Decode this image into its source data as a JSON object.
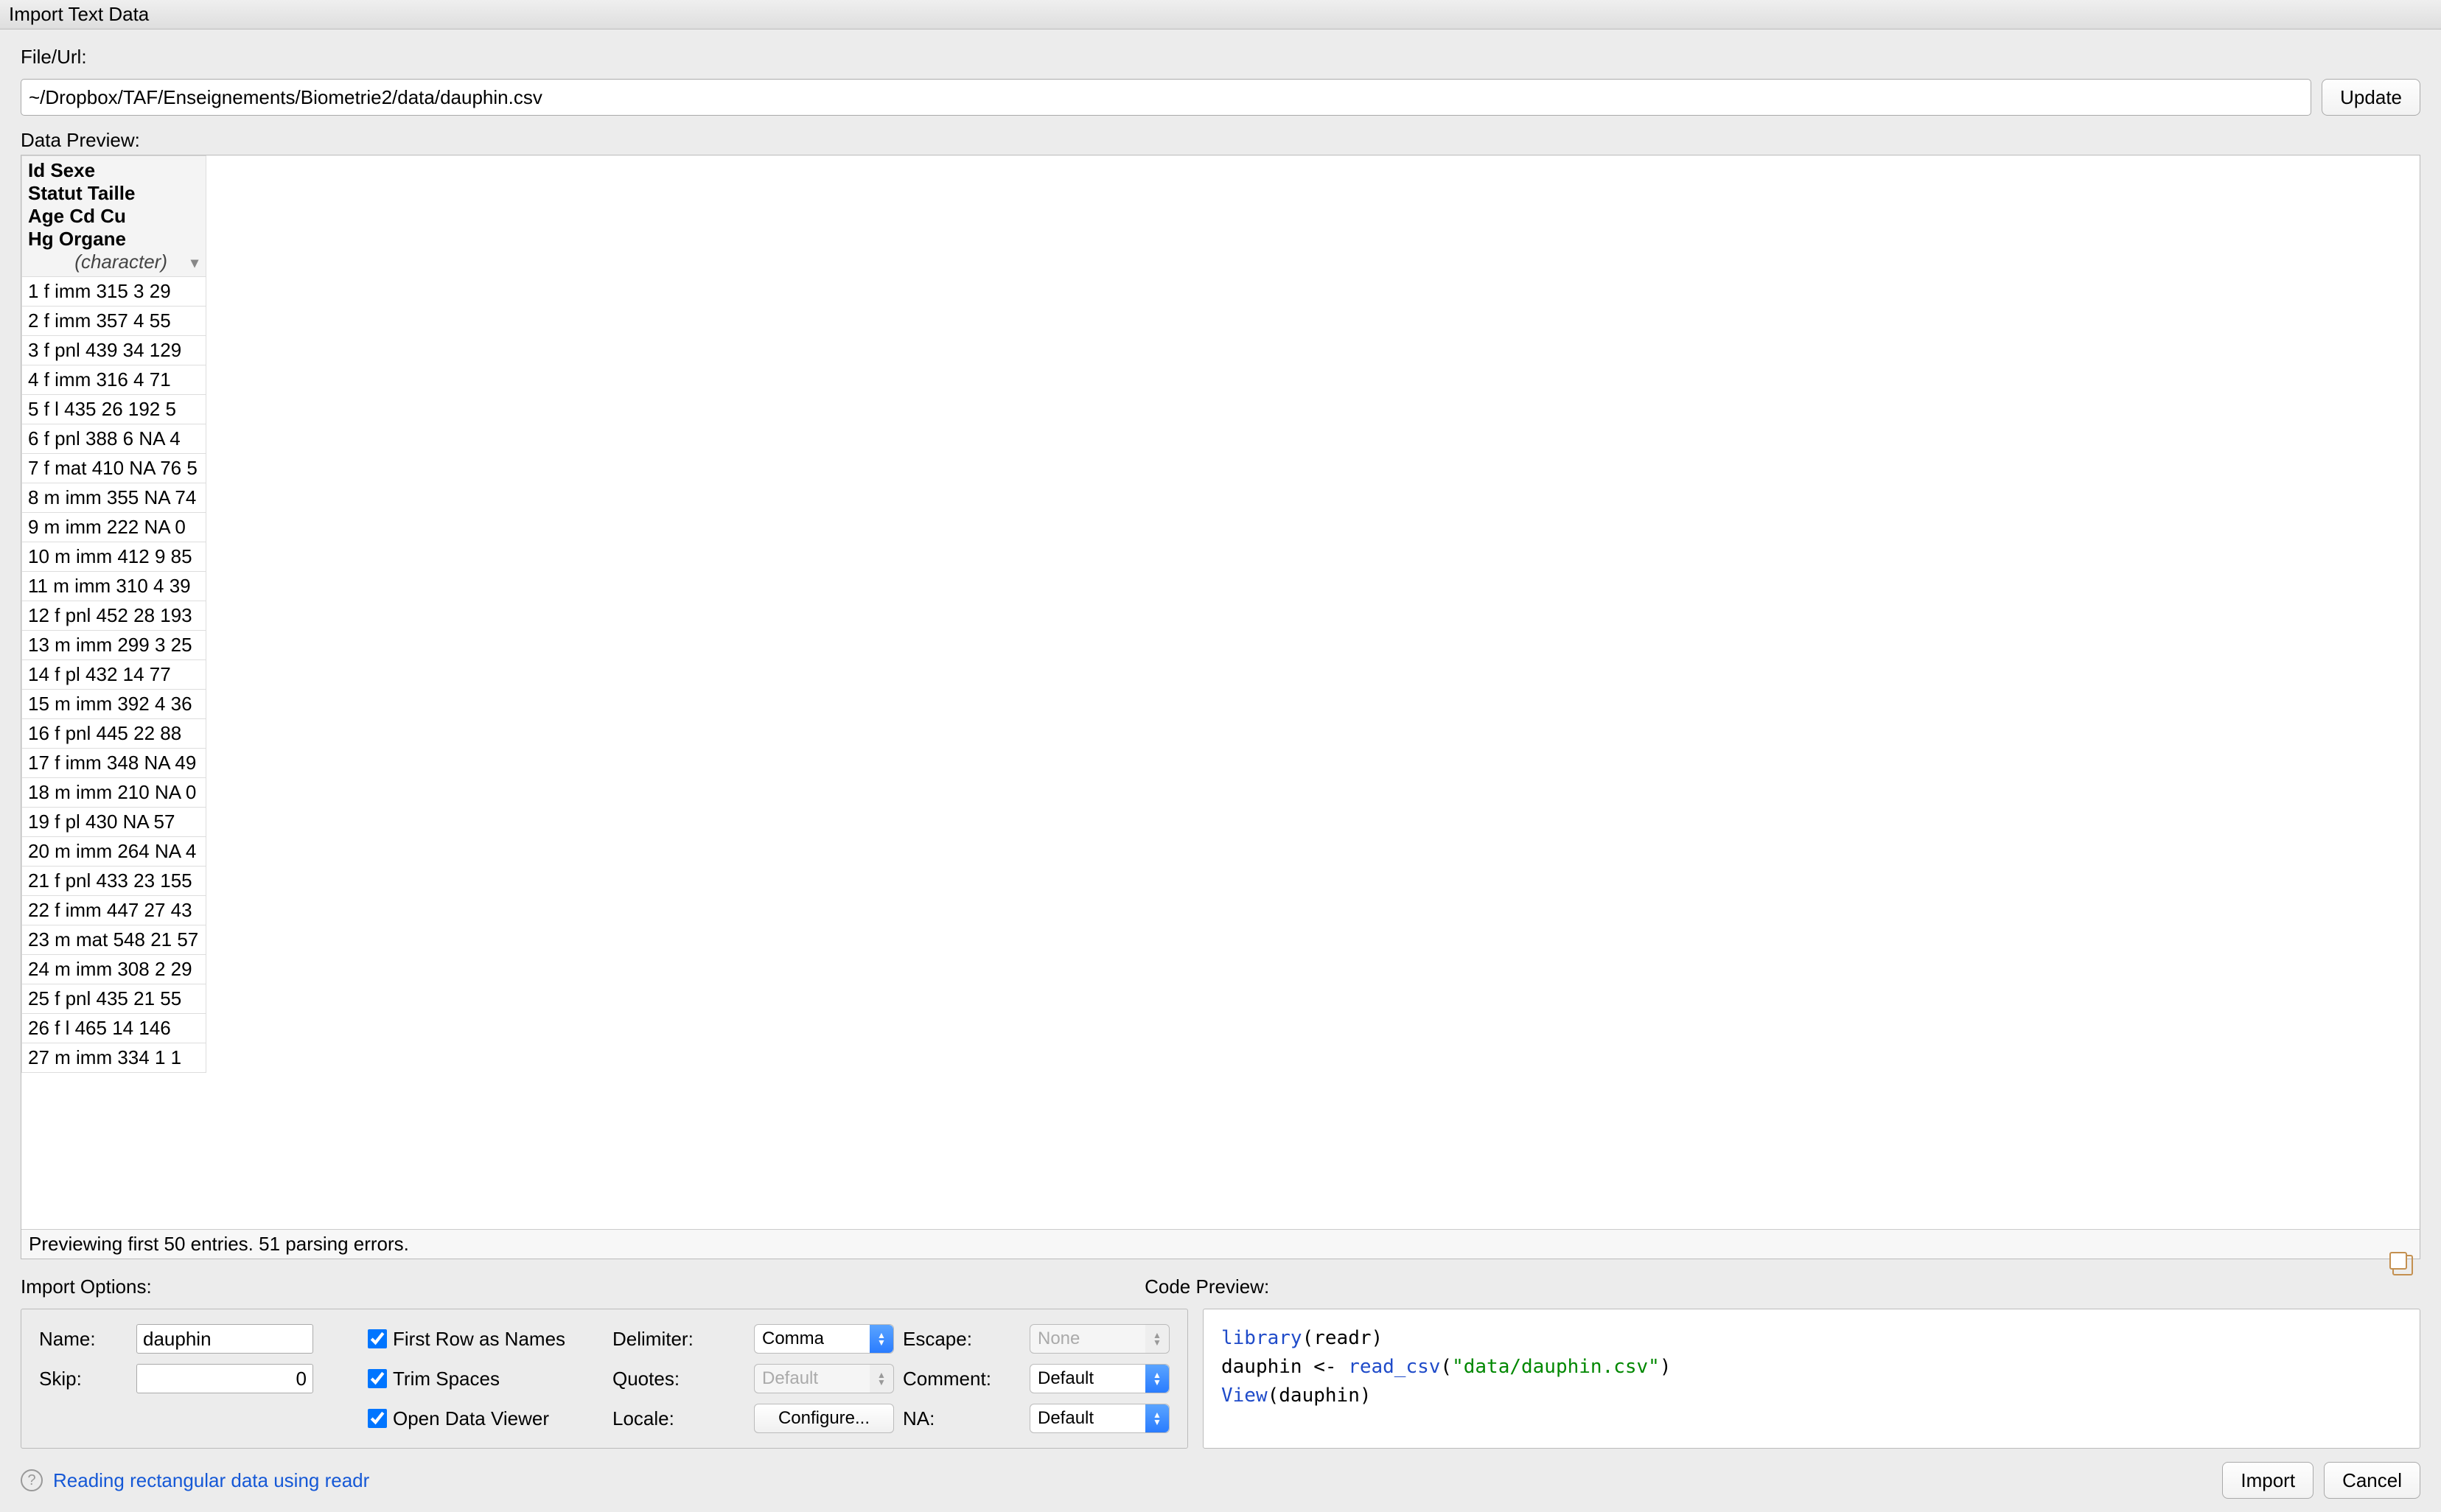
{
  "title": "Import Text Data",
  "file": {
    "label": "File/Url:",
    "value": "~/Dropbox/TAF/Enseignements/Biometrie2/data/dauphin.csv",
    "update_label": "Update"
  },
  "preview": {
    "label": "Data Preview:",
    "column_header": "Id Sexe Statut Taille Age Cd Cu Hg Organe",
    "column_type": "(character)",
    "rows": [
      "1 f imm 315 3 29",
      "2 f imm 357 4 55",
      "3 f pnl 439 34 129",
      "4 f imm 316 4 71",
      "5 f l 435 26 192 5",
      "6 f pnl 388 6 NA 4",
      "7 f mat 410 NA 76 5",
      "8 m imm 355 NA 74",
      "9 m imm 222 NA 0",
      "10 m imm 412 9 85",
      "11 m imm 310 4 39",
      "12 f pnl 452 28 193",
      "13 m imm 299 3 25",
      "14 f pl 432 14 77",
      "15 m imm 392 4 36",
      "16 f pnl 445 22 88",
      "17 f imm 348 NA 49",
      "18 m imm 210 NA 0",
      "19 f pl 430 NA 57",
      "20 m imm 264 NA 4",
      "21 f pnl 433 23 155",
      "22 f imm 447 27 43",
      "23 m mat 548 21 57",
      "24 m imm 308 2 29",
      "25 f pnl 435 21 55",
      "26 f l 465 14 146",
      "27 m imm 334 1 1"
    ],
    "status": "Previewing first 50 entries. 51 parsing errors."
  },
  "options": {
    "label": "Import Options:",
    "name_label": "Name:",
    "name_value": "dauphin",
    "skip_label": "Skip:",
    "skip_value": "0",
    "first_row": "First Row as Names",
    "trim": "Trim Spaces",
    "viewer": "Open Data Viewer",
    "delimiter_label": "Delimiter:",
    "delimiter_value": "Comma",
    "quotes_label": "Quotes:",
    "quotes_value": "Default",
    "locale_label": "Locale:",
    "locale_btn": "Configure...",
    "escape_label": "Escape:",
    "escape_value": "None",
    "comment_label": "Comment:",
    "comment_value": "Default",
    "na_label": "NA:",
    "na_value": "Default"
  },
  "code": {
    "label": "Code Preview:",
    "line1a": "library",
    "line1b": "(readr)",
    "line2a": "dauphin <- ",
    "line2b": "read_csv",
    "line2c": "(",
    "line2d": "\"data/dauphin.csv\"",
    "line2e": ")",
    "line3a": "View",
    "line3b": "(dauphin)"
  },
  "footer": {
    "help": "Reading rectangular data using readr",
    "import": "Import",
    "cancel": "Cancel"
  }
}
